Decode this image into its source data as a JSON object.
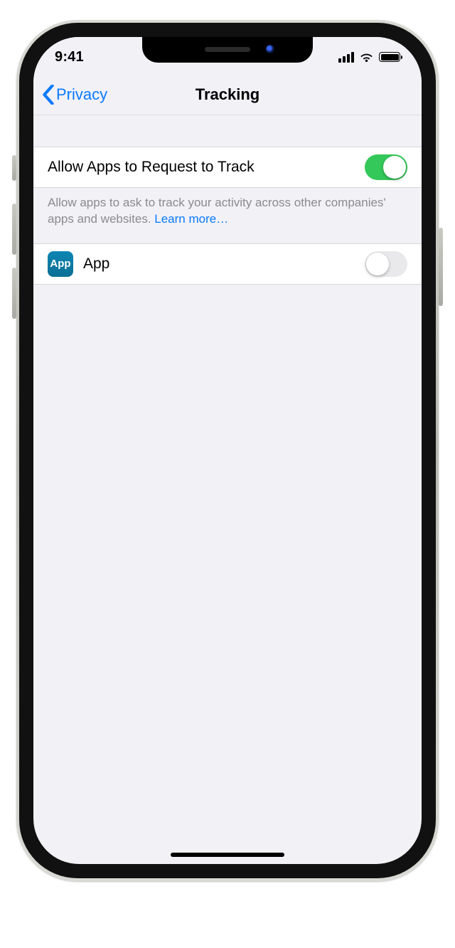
{
  "status": {
    "time": "9:41"
  },
  "nav": {
    "back_label": "Privacy",
    "title": "Tracking"
  },
  "settings": {
    "allow_request": {
      "label": "Allow Apps to Request to Track",
      "enabled": true
    },
    "footer_text": "Allow apps to ask to track your activity across other companies' apps and websites. ",
    "learn_more": "Learn more…",
    "apps": [
      {
        "icon_text": "App",
        "name": "App",
        "enabled": false
      }
    ]
  }
}
